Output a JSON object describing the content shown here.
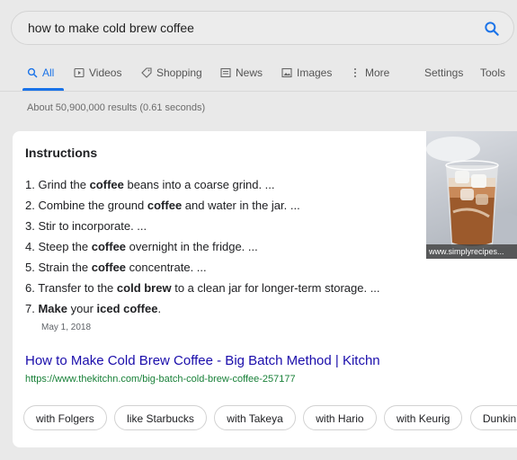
{
  "search": {
    "query": "how to make cold brew coffee"
  },
  "tabs": [
    {
      "label": "All",
      "icon": "search-icon"
    },
    {
      "label": "Videos",
      "icon": "play-icon"
    },
    {
      "label": "Shopping",
      "icon": "tag-icon"
    },
    {
      "label": "News",
      "icon": "newspaper-icon"
    },
    {
      "label": "Images",
      "icon": "image-icon"
    },
    {
      "label": "More",
      "icon": "more-vertical-icon"
    }
  ],
  "tools": {
    "settings": "Settings",
    "tools": "Tools"
  },
  "stats": "About 50,900,000 results (0.61 seconds)",
  "snippet": {
    "heading": "Instructions",
    "steps": [
      {
        "num": "1.",
        "parts": [
          {
            "t": "Grind the ",
            "b": false
          },
          {
            "t": "coffee",
            "b": true
          },
          {
            "t": " beans into a coarse grind. ...",
            "b": false
          }
        ]
      },
      {
        "num": "2.",
        "parts": [
          {
            "t": "Combine the ground ",
            "b": false
          },
          {
            "t": "coffee",
            "b": true
          },
          {
            "t": " and water in the jar. ...",
            "b": false
          }
        ]
      },
      {
        "num": "3.",
        "parts": [
          {
            "t": "Stir to incorporate. ...",
            "b": false
          }
        ]
      },
      {
        "num": "4.",
        "parts": [
          {
            "t": "Steep the ",
            "b": false
          },
          {
            "t": "coffee",
            "b": true
          },
          {
            "t": " overnight in the fridge. ...",
            "b": false
          }
        ]
      },
      {
        "num": "5.",
        "parts": [
          {
            "t": "Strain the ",
            "b": false
          },
          {
            "t": "coffee",
            "b": true
          },
          {
            "t": " concentrate. ...",
            "b": false
          }
        ]
      },
      {
        "num": "6.",
        "parts": [
          {
            "t": "Transfer to the ",
            "b": false
          },
          {
            "t": "cold brew",
            "b": true
          },
          {
            "t": " to a clean jar for longer-term storage. ...",
            "b": false
          }
        ]
      },
      {
        "num": "7.",
        "parts": [
          {
            "t": "Make",
            "b": true
          },
          {
            "t": " your ",
            "b": false
          },
          {
            "t": "iced coffee",
            "b": true
          },
          {
            "t": ".",
            "b": false
          }
        ]
      }
    ],
    "date": "May 1, 2018",
    "image_caption": "www.simplyrecipes...",
    "result_title": "How to Make Cold Brew Coffee - Big Batch Method | Kitchn",
    "result_url": "https://www.thekitchn.com/big-batch-cold-brew-coffee-257177"
  },
  "chips": [
    "with Folgers",
    "like Starbucks",
    "with Takeya",
    "with Hario",
    "with Keurig",
    "Dunkin Donuts"
  ],
  "colors": {
    "accent": "#1a73e8",
    "link": "#1a0dab",
    "url": "#188038"
  }
}
